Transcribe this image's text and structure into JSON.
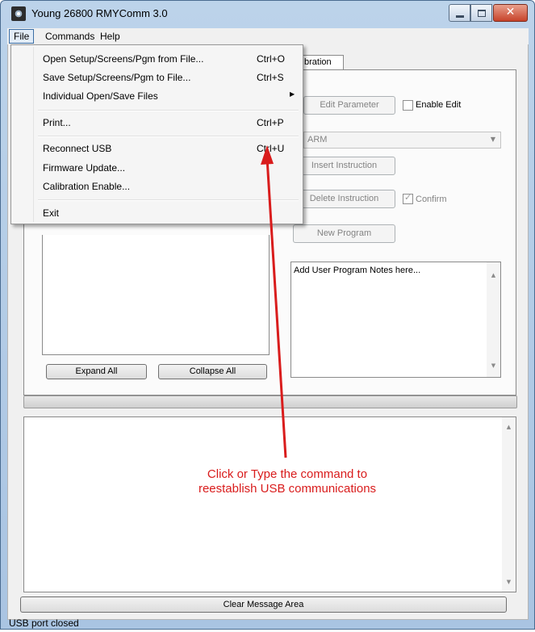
{
  "window": {
    "title": "Young 26800 RMYComm 3.0"
  },
  "menubar": {
    "file": "File",
    "commands": "Commands",
    "help": "Help"
  },
  "file_menu": {
    "open_setup": {
      "label": "Open Setup/Screens/Pgm from File...",
      "shortcut": "Ctrl+O"
    },
    "save_setup": {
      "label": "Save Setup/Screens/Pgm to File...",
      "shortcut": "Ctrl+S"
    },
    "individual": {
      "label": "Individual Open/Save Files"
    },
    "print": {
      "label": "Print...",
      "shortcut": "Ctrl+P"
    },
    "reconnect": {
      "label": "Reconnect USB",
      "shortcut": "Ctrl+U"
    },
    "firmware": {
      "label": "Firmware Update..."
    },
    "calibration": {
      "label": "Calibration Enable..."
    },
    "exit": {
      "label": "Exit"
    }
  },
  "tabs": {
    "calibration_partial": "bration"
  },
  "program_panel": {
    "edit_parameter": "Edit Parameter",
    "enable_edit": "Enable Edit",
    "instruction_combo": "ARM",
    "insert_instruction": "Insert  Instruction",
    "delete_instruction": "Delete Instruction",
    "confirm": "Confirm",
    "new_program": "New Program",
    "notes_placeholder": "Add User Program Notes here...",
    "expand_all": "Expand All",
    "collapse_all": "Collapse All"
  },
  "footer": {
    "clear_button": "Clear Message Area",
    "status": "USB port closed"
  },
  "annotation": {
    "line1": "Click or Type the command to",
    "line2": "reestablish USB communications"
  },
  "colors": {
    "annotation": "#d91c1c",
    "close_button": "#c7432a"
  }
}
